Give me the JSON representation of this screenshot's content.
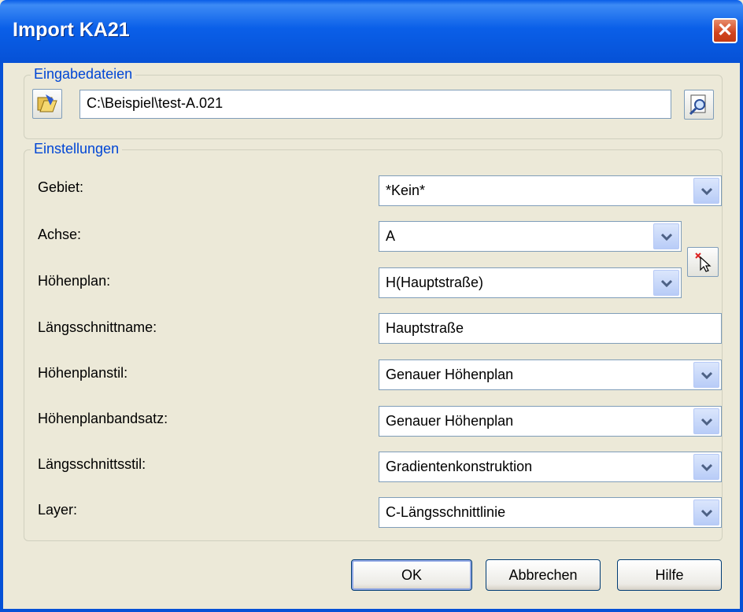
{
  "window": {
    "title": "Import KA21",
    "close_glyph": "✕"
  },
  "input_group": {
    "legend": "Eingabedateien",
    "file_path": "C:\\Beispiel\\test-A.021",
    "open_icon": "open-folder-icon",
    "browse_icon": "browse-icon"
  },
  "settings_group": {
    "legend": "Einstellungen",
    "fields": {
      "gebiet": {
        "label": "Gebiet:",
        "value": "*Kein*"
      },
      "achse": {
        "label": "Achse:",
        "value": "A"
      },
      "hoehenplan": {
        "label": "Höhenplan:",
        "value": "H(Hauptstraße)"
      },
      "laengsschnittname": {
        "label": "Längsschnittname:",
        "value": "Hauptstraße"
      },
      "hoehenplanstil": {
        "label": "Höhenplanstil:",
        "value": "Genauer Höhenplan"
      },
      "hoehenplanbandsatz": {
        "label": "Höhenplanbandsatz:",
        "value": "Genauer Höhenplan"
      },
      "laengsschnittsstil": {
        "label": "Längsschnittsstil:",
        "value": "Gradientenkonstruktion"
      },
      "layer": {
        "label": "Layer:",
        "value": "C-Längsschnittlinie"
      }
    },
    "pick_icon": "pick-from-drawing-icon"
  },
  "buttons": {
    "ok": "OK",
    "cancel": "Abbrechen",
    "help": "Hilfe"
  },
  "colors": {
    "titlebar": "#0a5fe8",
    "legend": "#0046d5",
    "dialog_bg": "#ece9d8"
  }
}
